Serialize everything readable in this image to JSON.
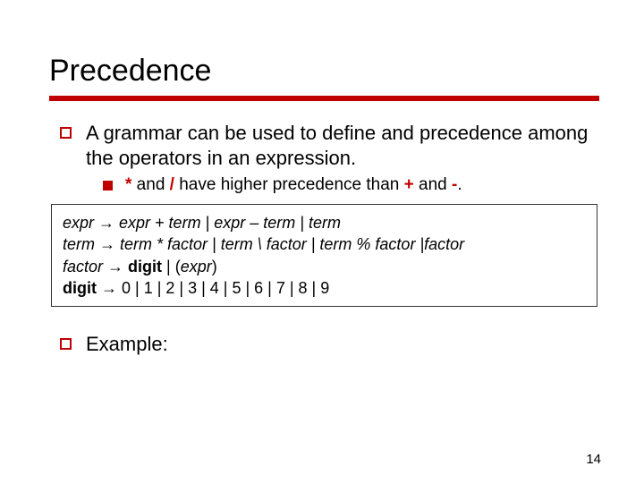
{
  "title": "Precedence",
  "bullet_main": "A grammar can be used to define and precedence among the operators in an expression.",
  "sub": {
    "pre": " ",
    "op1": "*",
    "mid1": " and ",
    "op2": "/",
    "mid2": " have higher precedence than ",
    "op3": "+",
    "mid3": " and ",
    "op4": "-",
    "post": "."
  },
  "grammar": {
    "l1_a": "expr",
    "l1_b": " → ",
    "l1_c": "expr + term | expr – term | term",
    "l2_a": "term",
    "l2_b": " → ",
    "l2_c": "term * factor | term \\ factor | term % factor |factor",
    "l3_a": "factor",
    "l3_b": "  → ",
    "l3_c": "digit",
    "l3_d": "  |  (",
    "l3_e": "expr",
    "l3_f": ")",
    "l4_a": "digit",
    "l4_b": " → 0 | 1 | 2 | 3 | 4 | 5 | 6 | 7 | 8 | 9"
  },
  "example_label": "Example:",
  "page_number": "14"
}
